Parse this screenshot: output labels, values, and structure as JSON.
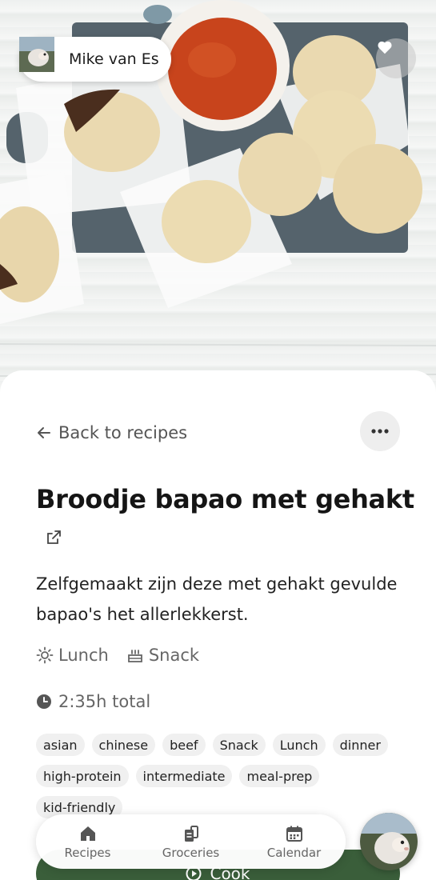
{
  "author": {
    "name": "Mike van Es"
  },
  "nav_back": {
    "label": "Back to recipes"
  },
  "recipe": {
    "title": "Broodje bapao met gehakt",
    "description": "Zelfgemaakt zijn deze met gehakt gevulde bapao's het allerlekkerst.",
    "meals": [
      "Lunch",
      "Snack"
    ],
    "total_time": "2:35h total",
    "tags": [
      "asian",
      "chinese",
      "beef",
      "Snack",
      "Lunch",
      "dinner",
      "high-protein",
      "intermediate",
      "meal-prep",
      "kid-friendly"
    ]
  },
  "cook_button": {
    "label": "Cook"
  },
  "bottom_nav": {
    "items": [
      {
        "label": "Recipes",
        "icon": "home-icon"
      },
      {
        "label": "Groceries",
        "icon": "groceries-icon"
      },
      {
        "label": "Calendar",
        "icon": "calendar-icon"
      }
    ]
  },
  "colors": {
    "accent": "#3a5e3a",
    "chip_bg": "#f0f0f0",
    "text_muted": "#666666"
  }
}
